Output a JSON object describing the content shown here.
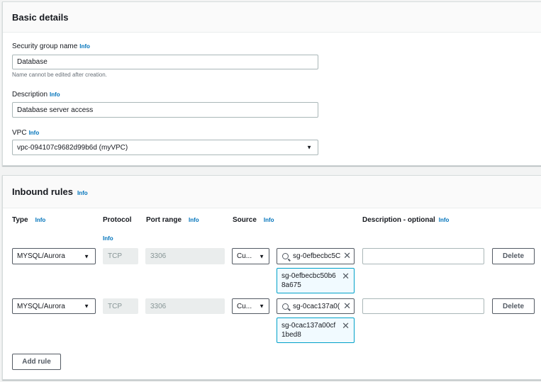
{
  "basic": {
    "title": "Basic details",
    "name_label": "Security group name",
    "name_value": "Database",
    "name_hint": "Name cannot be edited after creation.",
    "desc_label": "Description",
    "desc_value": "Database server access",
    "vpc_label": "VPC",
    "vpc_value": "vpc-094107c9682d99b6d (myVPC)"
  },
  "info": "Info",
  "inbound": {
    "title": "Inbound rules",
    "headers": {
      "type": "Type",
      "protocol": "Protocol",
      "port": "Port range",
      "source": "Source",
      "desc": "Description - optional"
    },
    "rows": [
      {
        "type": "MYSQL/Aurora",
        "protocol": "TCP",
        "port": "3306",
        "source": "Cu...",
        "search": "sg-0efbecbc5C",
        "token_l1": "sg-0efbecbc50b6",
        "token_l2": "8a675",
        "description": "",
        "delete": "Delete"
      },
      {
        "type": "MYSQL/Aurora",
        "protocol": "TCP",
        "port": "3306",
        "source": "Cu...",
        "search": "sg-0cac137a0(",
        "token_l1": "sg-0cac137a00cf",
        "token_l2": "1bed8",
        "description": "",
        "delete": "Delete"
      }
    ],
    "add_rule": "Add rule"
  },
  "icons": {
    "dropdown": "caret-down-icon",
    "search": "search-icon",
    "remove": "close-icon"
  }
}
